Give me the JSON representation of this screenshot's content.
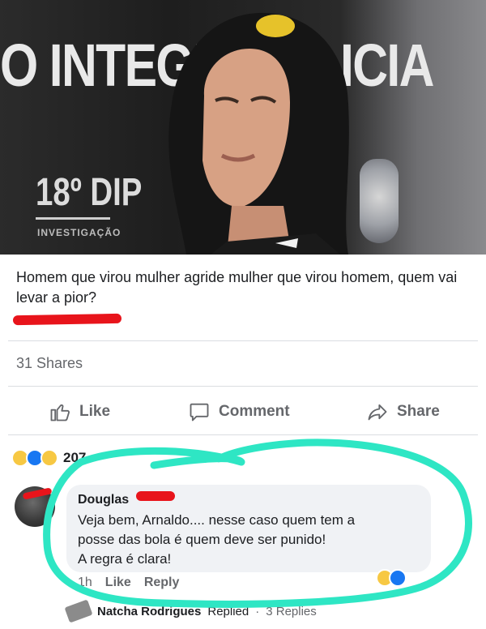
{
  "post": {
    "photo": {
      "banner_left": "O INTEGR",
      "banner_right": "ICIA",
      "station": "18º DIP",
      "station_sub": "INVESTIGAÇÃO"
    },
    "caption": "Homem que virou mulher agride mulher que virou homem, quem vai levar a pior?",
    "shares": "31 Shares"
  },
  "actions": {
    "like": "Like",
    "comment": "Comment",
    "share": "Share"
  },
  "reactions": {
    "count": "207",
    "icons": [
      "haha-reaction-icon",
      "like-reaction-icon",
      "wow-reaction-icon"
    ]
  },
  "comment": {
    "author": "Douglas",
    "text_lines": [
      "Veja bem, Arnaldo.... nesse caso quem tem a",
      "posse das bola é quem deve ser punido!",
      "A regra é clara!"
    ],
    "time": "1h",
    "like": "Like",
    "reply": "Reply"
  },
  "replies": {
    "name": "Natcha Rodrigues",
    "action": "Replied",
    "separator": "·",
    "count": "3 Replies"
  },
  "colors": {
    "accent": "#1877f2",
    "highlight": "#2ee6c4",
    "redaction": "#e8141b",
    "muted_text": "#65676b"
  }
}
